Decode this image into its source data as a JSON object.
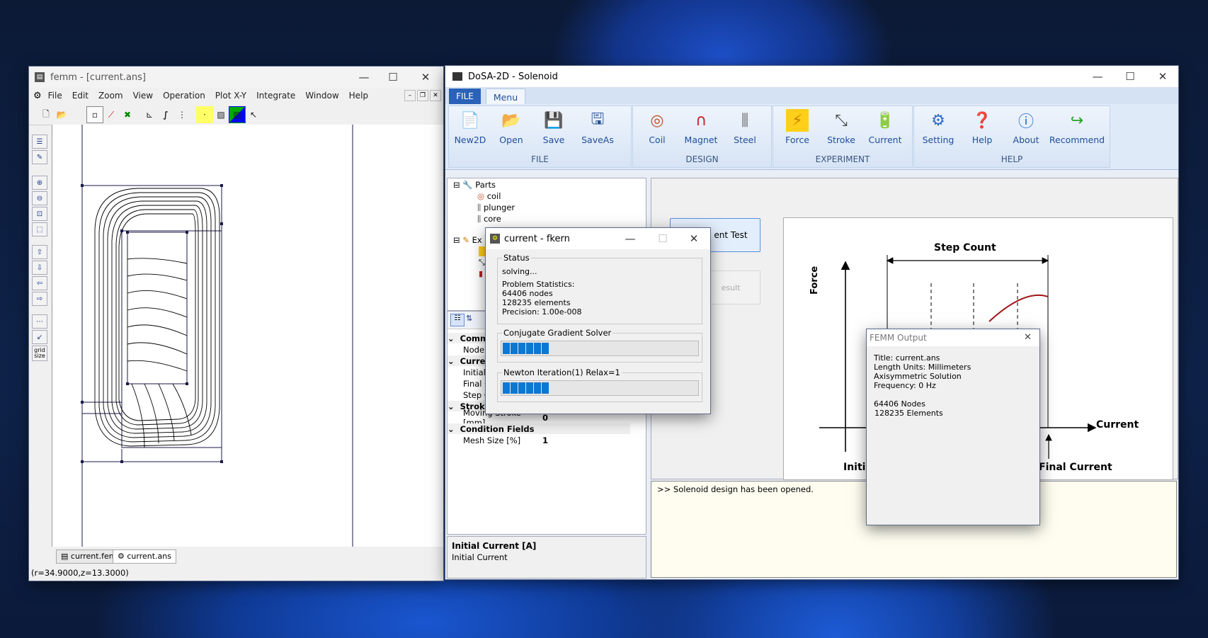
{
  "femm": {
    "title": "femm - [current.ans]",
    "menu": [
      "File",
      "Edit",
      "Zoom",
      "View",
      "Operation",
      "Plot X-Y",
      "Integrate",
      "Window",
      "Help"
    ],
    "doc_tabs": [
      "current.fem",
      "current.ans"
    ],
    "status": "(r=34.9000,z=13.3000)",
    "grid_size_label": "grid size"
  },
  "dosa": {
    "title": "DoSA-2D - Solenoid",
    "tabs": {
      "file": "FILE",
      "menu": "Menu"
    },
    "groups": {
      "file": {
        "label": "FILE",
        "buttons": [
          "New2D",
          "Open",
          "Save",
          "SaveAs"
        ]
      },
      "design": {
        "label": "DESIGN",
        "buttons": [
          "Coil",
          "Magnet",
          "Steel"
        ]
      },
      "experiment": {
        "label": "EXPERIMENT",
        "buttons": [
          "Force",
          "Stroke",
          "Current"
        ]
      },
      "help": {
        "label": "HELP",
        "buttons": [
          "Setting",
          "Help",
          "About",
          "Recommend"
        ]
      }
    },
    "tree": {
      "root": "Parts",
      "items": [
        "coil",
        "plunger",
        "core"
      ],
      "exp_partial": "Ex"
    },
    "props": {
      "cat_common_partial": "Comm",
      "node_partial": "Node",
      "cat_current_partial": "Curre",
      "initial_partial": "Initial C",
      "final_partial": "Final C",
      "step_partial": "Step C",
      "cat_stroke_partial": "Strok",
      "moving_stroke_label": "Moving Stroke [mm]",
      "moving_stroke_value": "0",
      "cat_condition": "Condition Fields",
      "mesh_size_label": "Mesh Size [%]",
      "mesh_size_value": "1"
    },
    "help_box": {
      "title": "Initial Current [A]",
      "desc": "Initial Current"
    },
    "test_button_partial": "ent Test",
    "result_button_partial": "esult",
    "diagram": {
      "step_count": "Step Count",
      "force": "Force",
      "current": "Current",
      "initial_partial": "Initia",
      "final_current": "Final Current"
    },
    "log": ">> Solenoid design has been opened."
  },
  "fkern": {
    "title": "current - fkern",
    "status_legend": "Status",
    "lines": [
      "solving...",
      "Problem Statistics:",
      "64406 nodes",
      "128235 elements",
      "Precision: 1.00e-008"
    ],
    "cg_label": "Conjugate Gradient Solver",
    "newton_label": "Newton Iteration(1) Relax=1",
    "cg_segments": 6,
    "newton_segments": 6
  },
  "femm_output": {
    "title": "FEMM Output",
    "lines": [
      "Title: current.ans",
      "Length Units: Millimeters",
      "Axisymmetric Solution",
      "Frequency: 0 Hz",
      "",
      "64406 Nodes",
      "128235 Elements"
    ]
  },
  "colors": {
    "accent": "#0b78d4",
    "ribbon": "#dfeaf8",
    "file_tab": "#2a62b8"
  }
}
